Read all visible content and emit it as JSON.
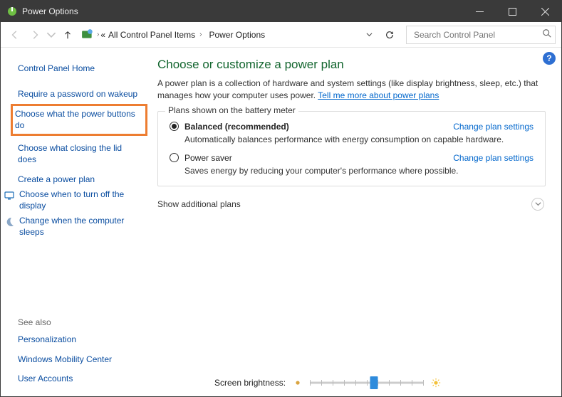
{
  "window": {
    "title": "Power Options"
  },
  "breadcrumb": {
    "back_chev": "«",
    "item1": "All Control Panel Items",
    "item2": "Power Options"
  },
  "search": {
    "placeholder": "Search Control Panel"
  },
  "sidebar": {
    "home": "Control Panel Home",
    "items": {
      "require_pw": "Require a password on wakeup",
      "power_buttons": "Choose what the power buttons do",
      "closing_lid": "Choose what closing the lid does",
      "create_plan": "Create a power plan",
      "turn_off_display": "Choose when to turn off the display",
      "computer_sleeps": "Change when the computer sleeps"
    },
    "see_also_label": "See also",
    "see_also": {
      "personalization": "Personalization",
      "mobility": "Windows Mobility Center",
      "user_accounts": "User Accounts"
    }
  },
  "main": {
    "heading": "Choose or customize a power plan",
    "desc1": "A power plan is a collection of hardware and system settings (like display brightness, sleep, etc.) that manages how your computer uses power. ",
    "desc_link": "Tell me more about power plans",
    "group_legend": "Plans shown on the battery meter",
    "plans": {
      "balanced": {
        "name": "Balanced (recommended)",
        "desc": "Automatically balances performance with energy consumption on capable hardware.",
        "change": "Change plan settings"
      },
      "power_saver": {
        "name": "Power saver",
        "desc": "Saves energy by reducing your computer's performance where possible.",
        "change": "Change plan settings"
      }
    },
    "show_additional": "Show additional plans",
    "brightness_label": "Screen brightness:"
  }
}
